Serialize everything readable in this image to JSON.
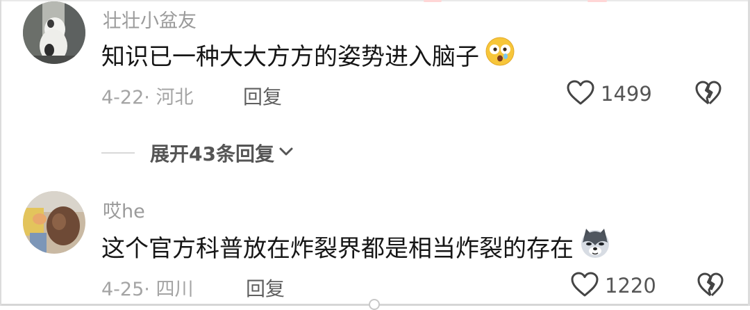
{
  "comments": [
    {
      "username": "壮壮小盆友",
      "text": "知识已一种大大方方的姿势进入脑子",
      "emoji": "astonished-face-emoji",
      "date_location": "4-22· 河北",
      "reply_label": "回复",
      "likes": "1499"
    },
    {
      "username": "哎he",
      "text": "这个官方科普放在炸裂界都是相当炸裂的存在",
      "emoji": "husky-dog-emoji",
      "date_location": "4-25· 四川",
      "reply_label": "回复",
      "likes": "1220"
    }
  ],
  "expand_replies": {
    "label": "展开43条回复"
  },
  "colors": {
    "username": "#9a9a9a",
    "text": "#161616",
    "meta": "#a4a4a4",
    "action": "#555555"
  }
}
